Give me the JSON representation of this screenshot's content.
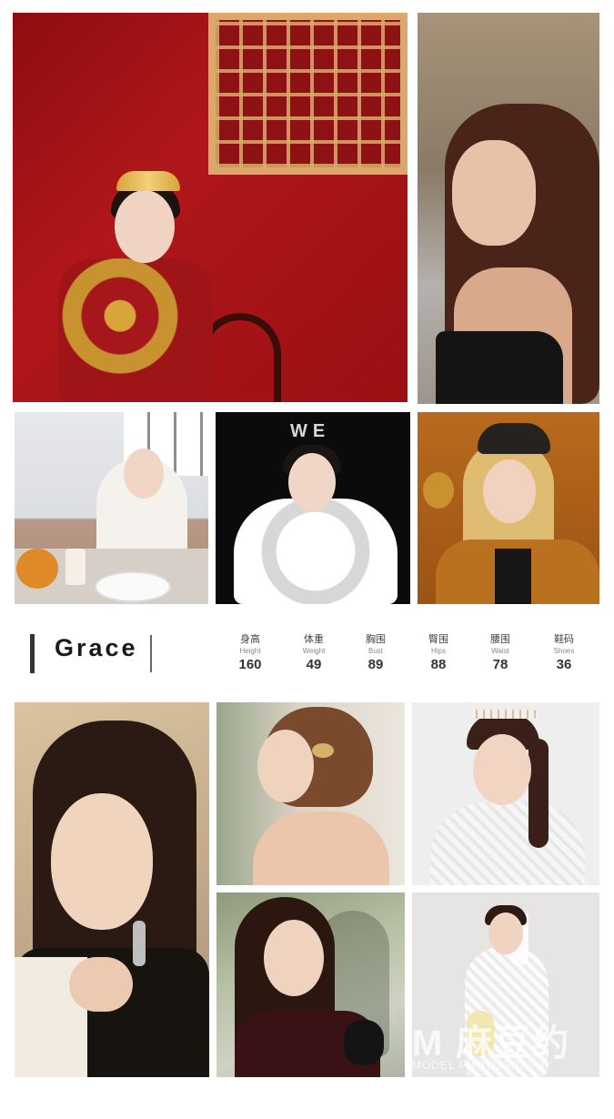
{
  "profile": {
    "name": "Grace",
    "stats": [
      {
        "cn": "身高",
        "en": "Height",
        "value": "160"
      },
      {
        "cn": "体重",
        "en": "Weight",
        "value": "49"
      },
      {
        "cn": "胸围",
        "en": "Bust",
        "value": "89"
      },
      {
        "cn": "臀围",
        "en": "Hips",
        "value": "88"
      },
      {
        "cn": "腰围",
        "en": "Waist",
        "value": "78"
      },
      {
        "cn": "鞋码",
        "en": "Shoes",
        "value": "36"
      }
    ]
  },
  "gallery": {
    "photo1_text": "",
    "photo4_overlay": "WE"
  },
  "watermark": {
    "cn": "M 麻豆约拍",
    "en": "MODEL PHOTOGRAPH"
  },
  "colors": {
    "background": "#ffffff",
    "text": "#1a1a1a",
    "accent_bar": "#333333"
  }
}
